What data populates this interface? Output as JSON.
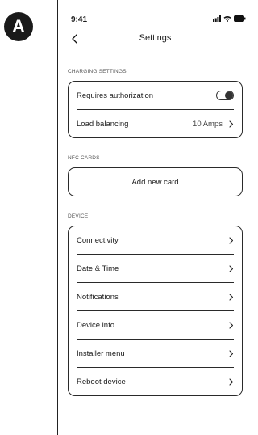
{
  "figure_badge": "A",
  "status": {
    "time": "9:41"
  },
  "nav": {
    "title": "Settings"
  },
  "charging": {
    "section_label": "CHARGING SETTINGS",
    "requires_auth_label": "Requires authorization",
    "requires_auth_enabled": true,
    "load_balancing_label": "Load balancing",
    "load_balancing_value": "10 Amps"
  },
  "nfc": {
    "section_label": "NFC CARDS",
    "add_card_label": "Add new card"
  },
  "device": {
    "section_label": "DEVICE",
    "items": [
      {
        "label": "Connectivity"
      },
      {
        "label": "Date & Time"
      },
      {
        "label": "Notifications"
      },
      {
        "label": "Device info"
      },
      {
        "label": "Installer menu"
      },
      {
        "label": "Reboot device"
      }
    ]
  },
  "icons": [
    "signal-icon",
    "wifi-icon",
    "battery-icon",
    "back-chevron-icon",
    "chevron-right-icon"
  ]
}
